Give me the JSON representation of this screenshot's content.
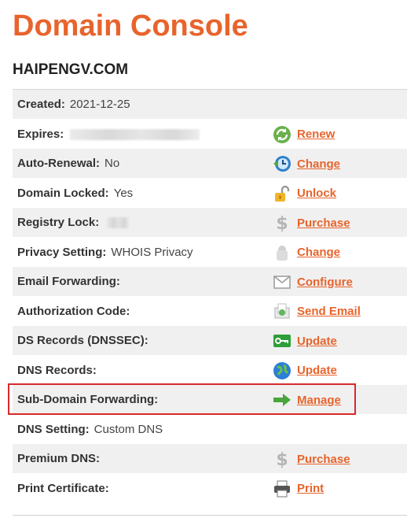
{
  "page": {
    "title": "Domain Console",
    "domain": "HAIPENGV.COM"
  },
  "colors": {
    "accent": "#e8642c",
    "highlight_border": "#d62a2a",
    "row_alt_bg": "#f0f0f0"
  },
  "rows": [
    {
      "label": "Created:",
      "value": "2021-12-25"
    },
    {
      "label": "Expires:",
      "action": {
        "icon": "renew-icon",
        "label": "Renew"
      }
    },
    {
      "label": "Auto-Renewal:",
      "value": "No",
      "action": {
        "icon": "clock-icon",
        "label": "Change"
      }
    },
    {
      "label": "Domain Locked:",
      "value": "Yes",
      "action": {
        "icon": "unlock-icon",
        "label": "Unlock"
      }
    },
    {
      "label": "Registry Lock:",
      "action": {
        "icon": "dollar-icon",
        "label": "Purchase"
      }
    },
    {
      "label": "Privacy Setting:",
      "value": "WHOIS Privacy",
      "action": {
        "icon": "privacy-icon",
        "label": "Change"
      }
    },
    {
      "label": "Email Forwarding:",
      "action": {
        "icon": "envelope-icon",
        "label": "Configure"
      }
    },
    {
      "label": "Authorization Code:",
      "action": {
        "icon": "send-email-icon",
        "label": "Send Email"
      }
    },
    {
      "label": "DS Records (DNSSEC):",
      "action": {
        "icon": "key-icon",
        "label": "Update"
      }
    },
    {
      "label": "DNS Records:",
      "action": {
        "icon": "globe-icon",
        "label": "Update"
      }
    },
    {
      "label": "Sub-Domain Forwarding:",
      "action": {
        "icon": "arrow-right-icon",
        "label": "Manage"
      }
    },
    {
      "label": "DNS Setting:",
      "value": "Custom DNS"
    },
    {
      "label": "Premium DNS:",
      "action": {
        "icon": "dollar-icon",
        "label": "Purchase"
      }
    },
    {
      "label": "Print Certificate:",
      "action": {
        "icon": "printer-icon",
        "label": "Print"
      }
    }
  ]
}
